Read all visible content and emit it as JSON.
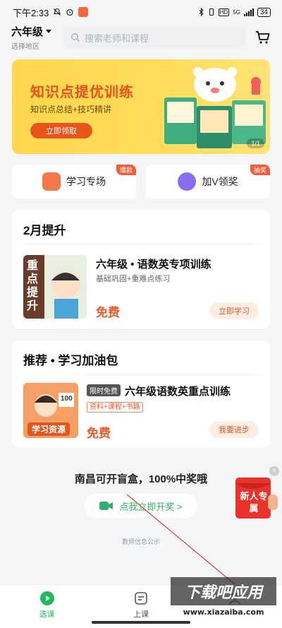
{
  "status_bar": {
    "time": "下午2:33",
    "network_label": "HD",
    "signal_label": "5G",
    "battery": "34"
  },
  "header": {
    "grade": "六年级",
    "region": "选择地区",
    "search_placeholder": "搜索老师和课程"
  },
  "banner": {
    "title": "知识点提优训练",
    "subtitle": "知识点总结+技巧精讲",
    "button": "立即领取",
    "page": "1/1"
  },
  "shortcuts": [
    {
      "label": "学习专场",
      "tag": "爆款",
      "icon": "bag-icon",
      "color": "#f27a4a"
    },
    {
      "label": "加V领奖",
      "tag": "抽奖",
      "icon": "gift-icon",
      "color": "#8a6cf0"
    }
  ],
  "section_feb": {
    "title": "2月提升",
    "course": {
      "thumb_text": "重点提升",
      "name": "六年级 • 语数英专项训练",
      "desc": "基础巩固+重难点练习",
      "price": "免费",
      "cta": "立即学习"
    }
  },
  "section_recommend": {
    "title": "推荐 • 学习加油包",
    "course": {
      "thumb_text": "学习资源",
      "thumb_badge": "100",
      "badge": "限时免费",
      "name": "六年级语数英重点训练",
      "tags": "资料+课程+书籍",
      "price": "免费",
      "cta": "我要进步"
    }
  },
  "promo": {
    "text": "南昌可开盲盒，100%中奖哦",
    "button": "点我立即开奖 >"
  },
  "disclosure": "教师信息公示",
  "float_ad": {
    "text": "新人专属"
  },
  "tabs": [
    {
      "label": "选课",
      "icon": "play-circle-icon",
      "active": true
    },
    {
      "label": "上课",
      "icon": "classroom-icon",
      "active": false
    },
    {
      "label": "",
      "icon": "user-icon",
      "active": false
    }
  ],
  "watermark": {
    "title": "下载吧应用",
    "url": "www.xiazaiba.com"
  },
  "colors": {
    "accent_green": "#1dbb5e",
    "price_orange": "#ee5a2a",
    "banner_yellow": "#ffd64f"
  }
}
